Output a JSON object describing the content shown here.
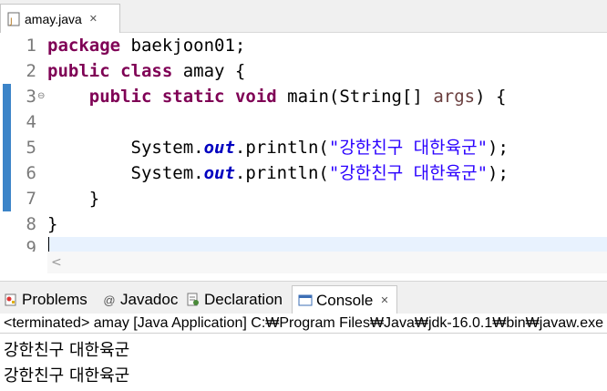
{
  "editor_tab": {
    "filename": "amay.java",
    "close_glyph": "✕"
  },
  "line_numbers": [
    "1",
    "2",
    "3",
    "4",
    "5",
    "6",
    "7",
    "8",
    "9"
  ],
  "code": {
    "l1_kw": "package",
    "l1_rest": " baekjoon01;",
    "l2_kw1": "public",
    "l2_kw2": "class",
    "l2_rest": " amay {",
    "l3_indent": "    ",
    "l3_kw1": "public",
    "l3_kw2": "static",
    "l3_kw3": "void",
    "l3_mid": " main(String[] ",
    "l3_param": "args",
    "l3_end": ") {",
    "l5_pre": "        System.",
    "l5_field": "out",
    "l5_mid": ".println(",
    "l5_str": "\"강한친구 대한육군\"",
    "l5_end": ");",
    "l6_pre": "        System.",
    "l6_field": "out",
    "l6_mid": ".println(",
    "l6_str": "\"강한친구 대한육군\"",
    "l6_end": ");",
    "l7": "    }",
    "l8": "}"
  },
  "panel_tabs": {
    "problems": "Problems",
    "javadoc": "Javadoc",
    "declaration": "Declaration",
    "console": "Console"
  },
  "console": {
    "header": "<terminated> amay [Java Application] C:₩Program Files₩Java₩jdk-16.0.1₩bin₩javaw.exe",
    "output": [
      "강한친구 대한육군",
      "강한친구 대한육군"
    ]
  },
  "colors": {
    "keyword": "#7f0055",
    "string": "#2a00ff",
    "field": "#0000c0",
    "change_bar": "#3c84c8"
  }
}
